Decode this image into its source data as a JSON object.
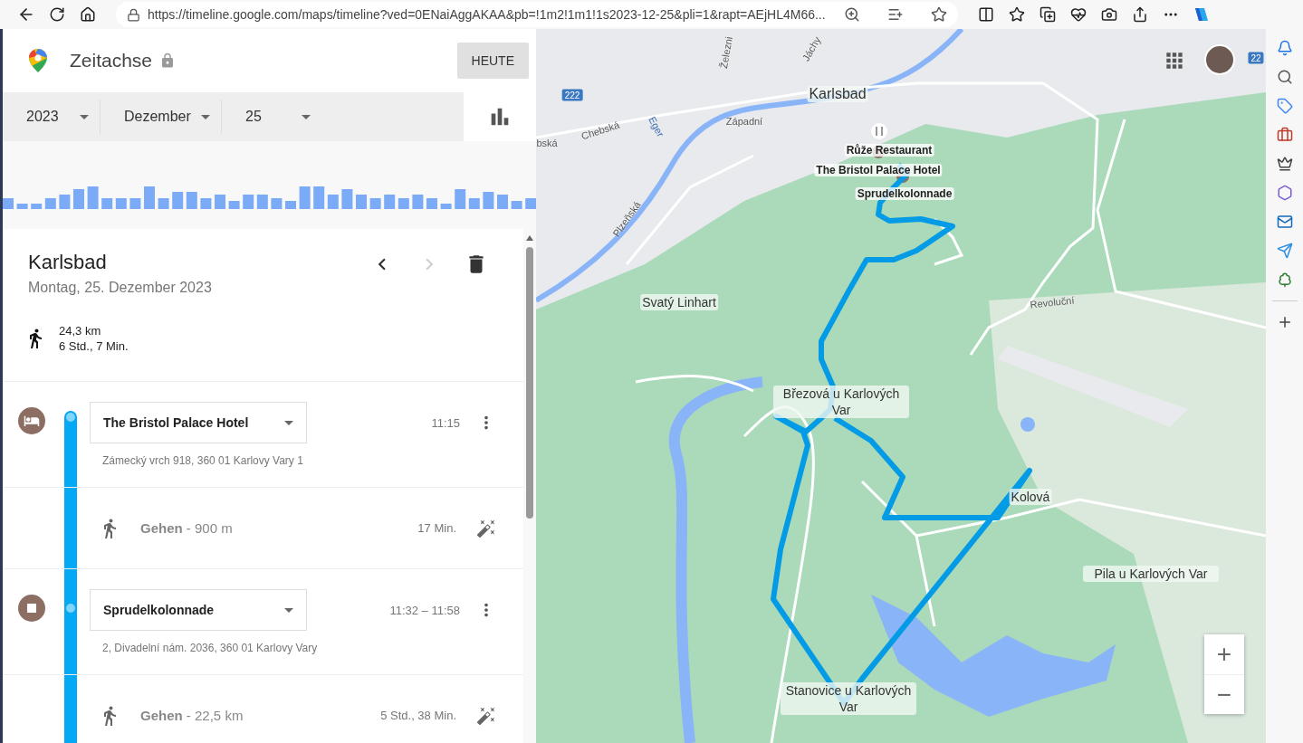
{
  "browser": {
    "url": "https://timeline.google.com/maps/timeline?ved=0ENaiAggAKAA&pb=!1m2!1m1!1s2023-12-25&pli=1&rapt=AEjHL4M66..."
  },
  "header": {
    "title": "Zeitachse",
    "today_button": "HEUTE"
  },
  "date_selector": {
    "year": "2023",
    "month": "Dezember",
    "day": "25",
    "chart_tab": {
      "selected": true
    }
  },
  "day": {
    "title": "Karlsbad",
    "date": "Montag, 25. Dezember 2023",
    "nav": [
      {
        "kind": "prev",
        "disabled": false
      },
      {
        "kind": "next",
        "disabled": true
      }
    ],
    "distance": "24,3 km",
    "duration": "6 Std., 7 Min."
  },
  "segments": [
    {
      "kind": "lodging",
      "name": "The Bristol Palace Hotel",
      "time": "11:15",
      "address": "Zámecký vrch 918, 360 01 Karlovy Vary 1"
    },
    {
      "kind": "walk",
      "activity": "Gehen",
      "distance": "- 900 m",
      "time": "17 Min."
    },
    {
      "kind": "visit",
      "name": "Sprudelkolonnade",
      "time": "11:32 – 11:58",
      "address": "2, Divadelní nám. 2036, 360 01 Karlovy Vary"
    },
    {
      "kind": "walk",
      "activity": "Gehen",
      "distance": "- 22,5 km",
      "time": "5 Std., 38 Min."
    }
  ],
  "map": {
    "labels": [
      {
        "kind": "town",
        "text": "Karlsbad"
      },
      {
        "kind": "street",
        "text": "Západní"
      },
      {
        "kind": "street",
        "text": "Chebská"
      },
      {
        "kind": "street",
        "text": "bská"
      },
      {
        "kind": "river",
        "text": "Eger"
      },
      {
        "kind": "street",
        "text": "Plzeňská"
      },
      {
        "kind": "street",
        "text": "Železni"
      },
      {
        "kind": "street",
        "text": "Jáchy"
      },
      {
        "kind": "poi",
        "text": "Růže Restaurant"
      },
      {
        "kind": "poi",
        "text": "The Bristol Palace Hotel"
      },
      {
        "kind": "poi",
        "text": "Sprudelkolonnade"
      },
      {
        "kind": "town",
        "text": "Svatý Linhart"
      },
      {
        "kind": "street",
        "text": "Revoluční"
      },
      {
        "kind": "town",
        "text": "Březová u Karlových Var"
      },
      {
        "kind": "town",
        "text": "Kolová"
      },
      {
        "kind": "town",
        "text": "Pila u Karlových Var"
      },
      {
        "kind": "town",
        "text": "Stanovice u Karlových Var"
      },
      {
        "kind": "road",
        "text": "222"
      },
      {
        "kind": "road",
        "text": "22"
      }
    ],
    "zoom_in": "+",
    "zoom_out": "−"
  }
}
